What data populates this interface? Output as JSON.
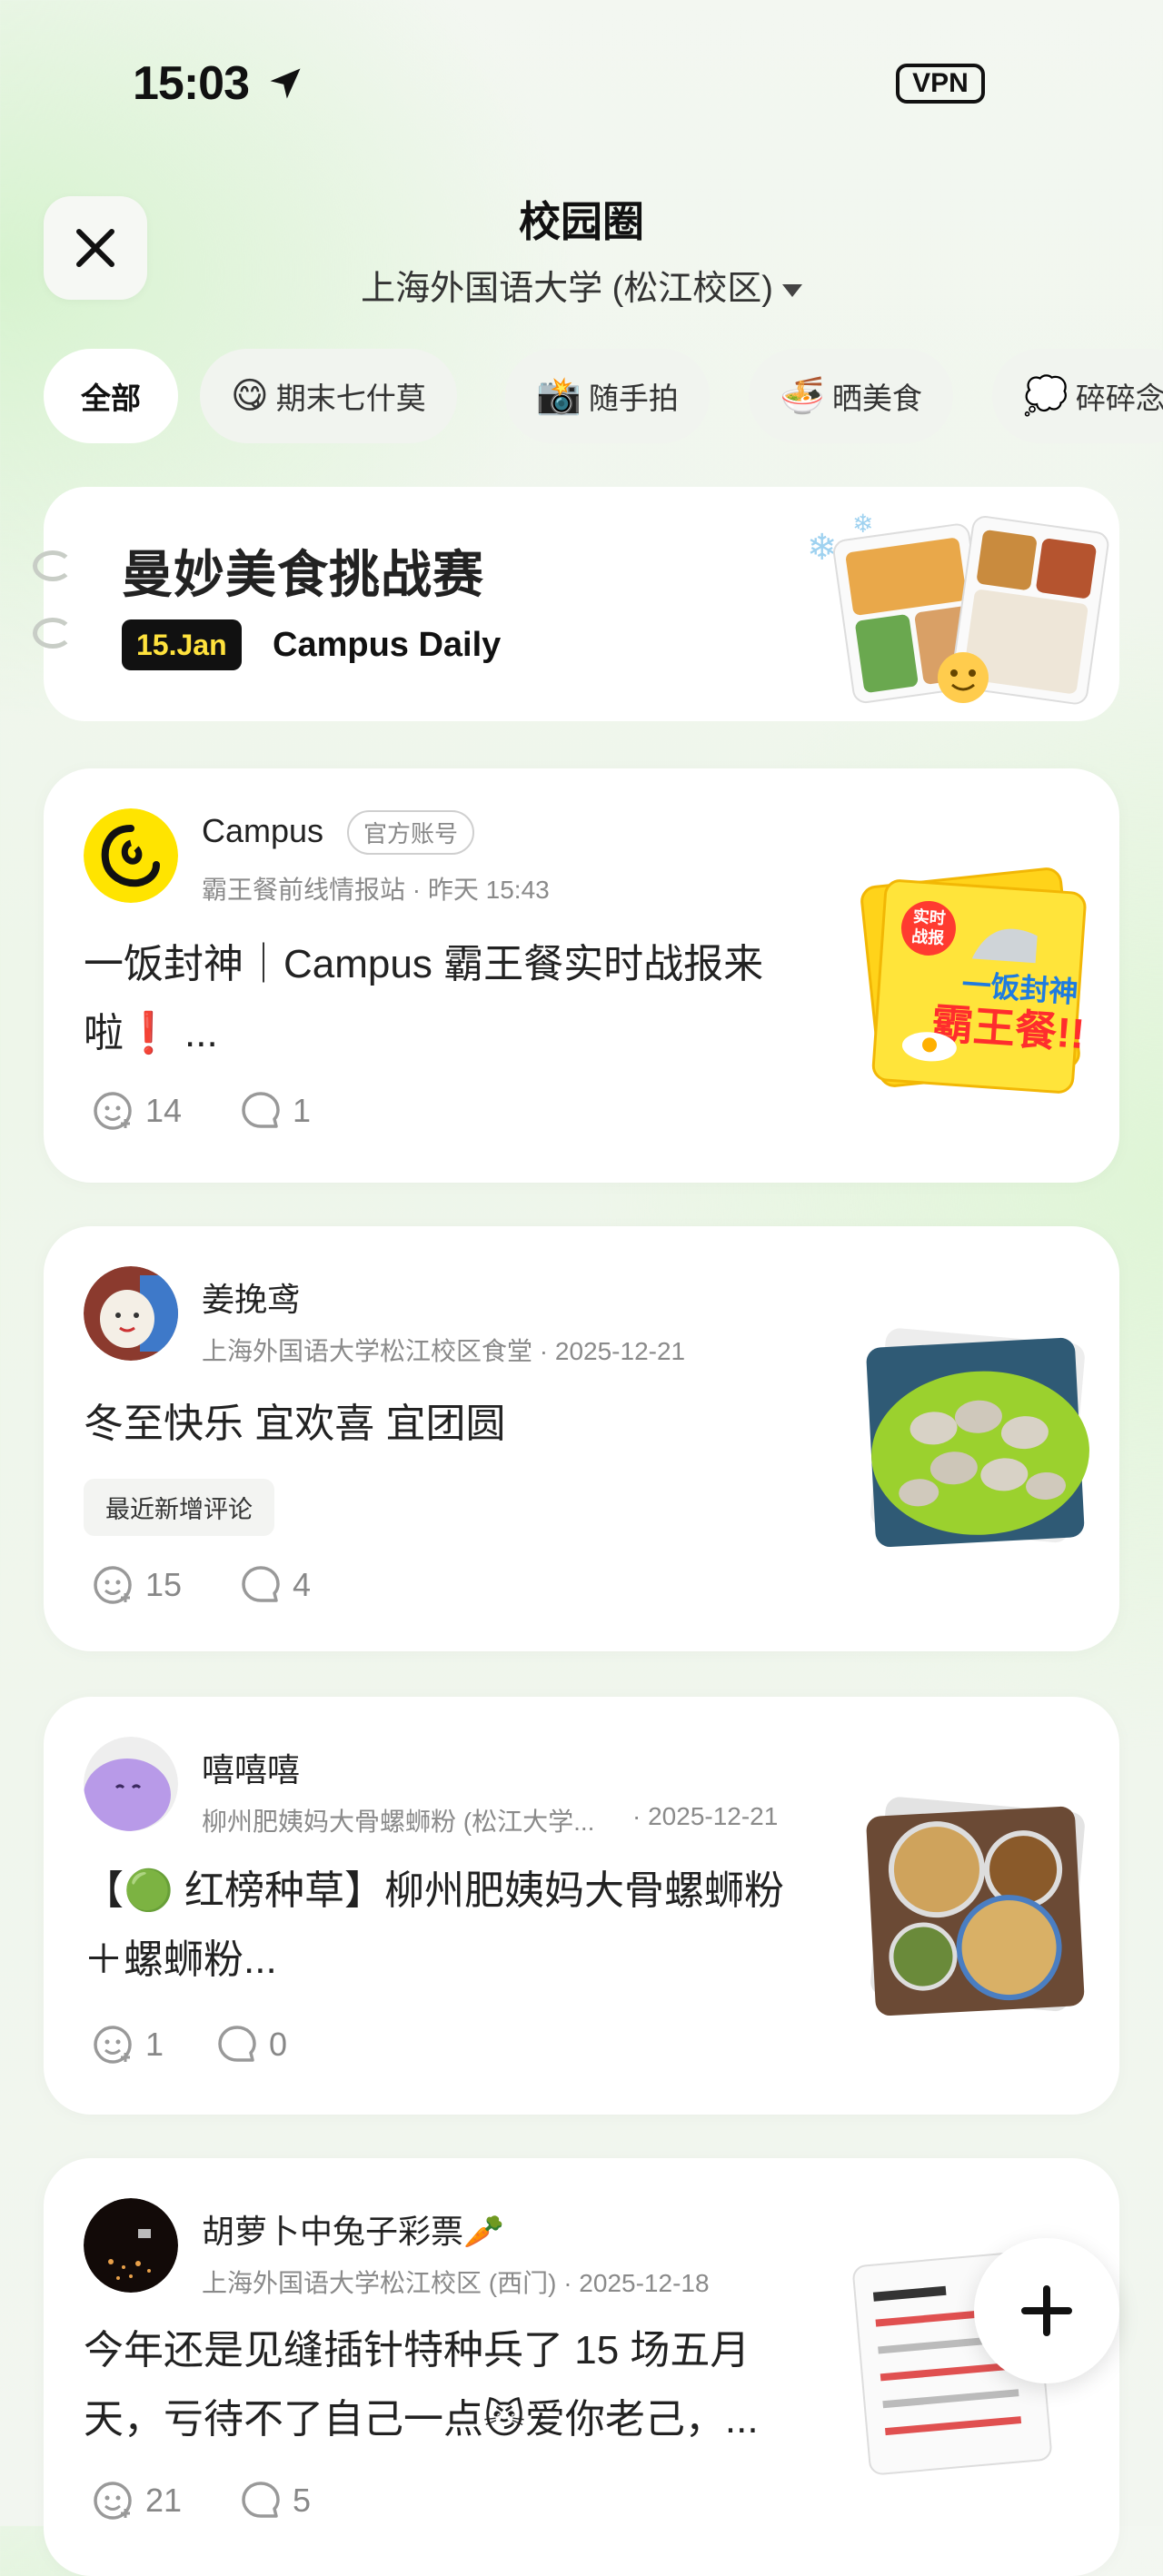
{
  "status_bar": {
    "time": "15:03",
    "vpn_label": "VPN"
  },
  "header": {
    "title": "校园圈",
    "subtitle": "上海外国语大学 (松江校区)"
  },
  "chips": [
    {
      "label": "全部",
      "emoji": ""
    },
    {
      "label": "期末七什莫",
      "emoji": "😋"
    },
    {
      "label": "随手拍",
      "emoji": "📸"
    },
    {
      "label": "晒美食",
      "emoji": "🍜"
    },
    {
      "label": "碎碎念",
      "emoji": "💭"
    }
  ],
  "banner": {
    "title": "曼妙美食挑战赛",
    "date": "15.Jan",
    "brand": "Campus Daily"
  },
  "posts": [
    {
      "author": "Campus",
      "badge": "官方账号",
      "meta": "霸王餐前线情报站 · 昨天 15:43",
      "line1": "一饭封神｜Campus 霸王餐实时战报来",
      "line2": "啦❗ ...",
      "likes": "14",
      "comments": "1",
      "thumb_lines": [
        "实时",
        "战报",
        "一饭封神",
        "霸王餐!!"
      ]
    },
    {
      "author": "姜挽鸢",
      "meta": "上海外国语大学松江校区食堂 · 2025-12-21",
      "line1": "冬至快乐  宜欢喜  宜团圆",
      "tag": "最近新增评论",
      "likes": "15",
      "comments": "4"
    },
    {
      "author": "嘻嘻嘻",
      "meta_place": "柳州肥姨妈大骨螺蛳粉 (松江大学...",
      "meta_date": "· 2025-12-21",
      "line1": "【🟢 红榜种草】柳州肥姨妈大骨螺蛳粉",
      "line2": "＋螺蛳粉...",
      "likes": "1",
      "comments": "0"
    },
    {
      "author": "胡萝卜中兔子彩票🥕",
      "meta": "上海外国语大学松江校区 (西门) · 2025-12-18",
      "line1": "今年还是见缝插针特种兵了 15 场五月",
      "line2": "天，亏待不了自己一点😼爱你老己，...",
      "likes": "21",
      "comments": "5"
    }
  ],
  "colors": {
    "brand_yellow": "#ffe23d",
    "text": "#222222",
    "muted": "#8a8a8a"
  }
}
